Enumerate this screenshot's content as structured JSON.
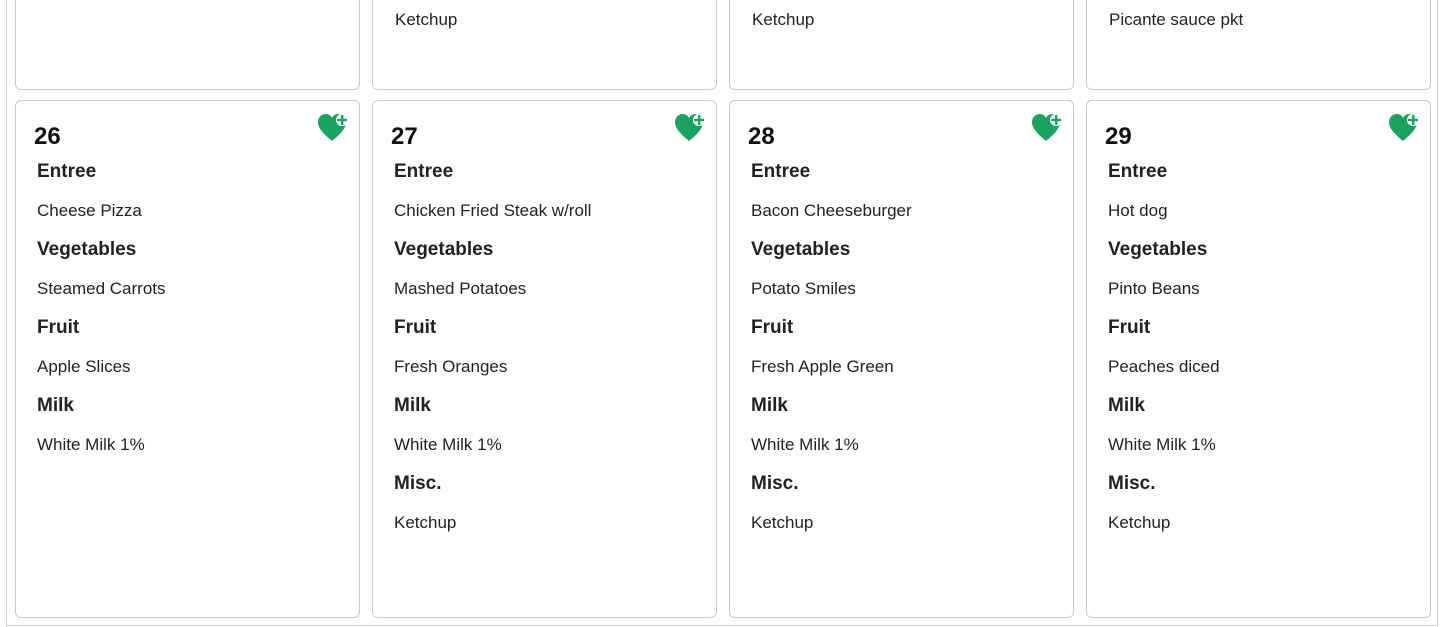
{
  "previous_row": [
    {
      "item": ""
    },
    {
      "item": "Ketchup"
    },
    {
      "item": "Ketchup"
    },
    {
      "item": "Picante sauce pkt"
    }
  ],
  "days": [
    {
      "day": "26",
      "sections": [
        {
          "title": "Entree",
          "item": "Cheese Pizza"
        },
        {
          "title": "Vegetables",
          "item": "Steamed Carrots"
        },
        {
          "title": "Fruit",
          "item": "Apple Slices"
        },
        {
          "title": "Milk",
          "item": "White Milk 1%"
        }
      ]
    },
    {
      "day": "27",
      "sections": [
        {
          "title": "Entree",
          "item": "Chicken Fried Steak w/roll"
        },
        {
          "title": "Vegetables",
          "item": "Mashed Potatoes"
        },
        {
          "title": "Fruit",
          "item": "Fresh Oranges"
        },
        {
          "title": "Milk",
          "item": "White Milk 1%"
        },
        {
          "title": "Misc.",
          "item": "Ketchup"
        }
      ]
    },
    {
      "day": "28",
      "sections": [
        {
          "title": "Entree",
          "item": "Bacon Cheeseburger"
        },
        {
          "title": "Vegetables",
          "item": "Potato Smiles"
        },
        {
          "title": "Fruit",
          "item": "Fresh Apple Green"
        },
        {
          "title": "Milk",
          "item": "White Milk 1%"
        },
        {
          "title": "Misc.",
          "item": "Ketchup"
        }
      ]
    },
    {
      "day": "29",
      "sections": [
        {
          "title": "Entree",
          "item": "Hot dog"
        },
        {
          "title": "Vegetables",
          "item": "Pinto Beans"
        },
        {
          "title": "Fruit",
          "item": "Peaches diced"
        },
        {
          "title": "Milk",
          "item": "White Milk 1%"
        },
        {
          "title": "Misc.",
          "item": "Ketchup"
        }
      ]
    }
  ],
  "icons": {
    "favorite": "heart-plus-icon"
  },
  "colors": {
    "accent": "#1aa260",
    "border": "#c9c9d2"
  }
}
